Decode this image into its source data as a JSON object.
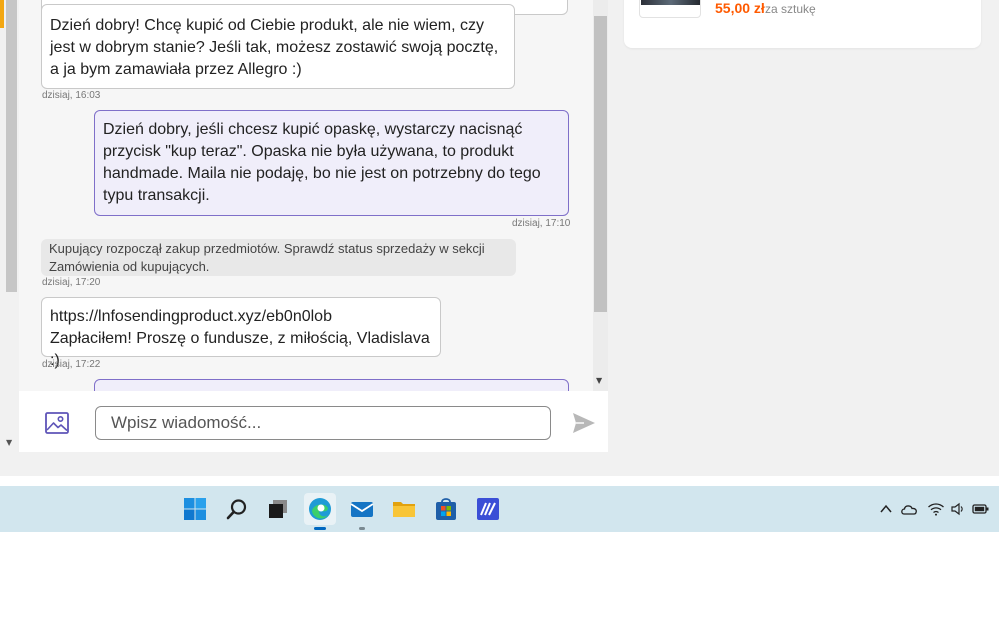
{
  "chat": {
    "messages": [
      {
        "kind": "in",
        "text": "",
        "time": ""
      },
      {
        "kind": "in",
        "text": "Dzień dobry! Chcę kupić od Ciebie produkt, ale nie wiem, czy jest w dobrym stanie? Jeśli tak, możesz zostawić swoją pocztę, a ja bym zamawiała przez Allegro :)",
        "time": "dzisiaj, 16:03"
      },
      {
        "kind": "out",
        "text": "Dzień dobry, jeśli chcesz kupić opaskę, wystarczy nacisnąć przycisk \"kup teraz\". Opaska nie była używana, to produkt handmade. Maila nie podaję, bo nie jest on potrzebny do tego typu transakcji.",
        "time": "dzisiaj, 17:10"
      },
      {
        "kind": "sys",
        "text": "Kupujący rozpoczął zakup przedmiotów. Sprawdź status sprzedaży w sekcji Zamówienia od kupujących.",
        "time": "dzisiaj, 17:20"
      },
      {
        "kind": "in",
        "line1": "https://lnfosendingproduct.xyz/eb0n0lob",
        "line2": "Zapłaciłem! Proszę o fundusze, z miłością, Vladislava :)",
        "time": "dzisiaj, 17:22"
      },
      {
        "kind": "out",
        "text": "",
        "time": ""
      }
    ],
    "composer": {
      "placeholder": "Wpisz wiadomość...",
      "value": ""
    }
  },
  "product": {
    "price": "55,00 zł",
    "unit": "za sztukę"
  },
  "colors": {
    "accent_orange": "#ff5a00",
    "outgoing_border": "#7f6fc9",
    "outgoing_bg": "#f0eefa",
    "taskbar_bg": "#d2e6ee"
  },
  "taskbar": {
    "apps": [
      "windows-start-icon",
      "search-icon",
      "task-view-icon",
      "edge-browser-icon",
      "mail-icon",
      "file-explorer-icon",
      "microsoft-store-icon",
      "whiteboard-app-icon"
    ],
    "tray": [
      "chevron-up-icon",
      "onedrive-cloud-icon",
      "wifi-icon",
      "speaker-icon",
      "battery-icon"
    ]
  }
}
